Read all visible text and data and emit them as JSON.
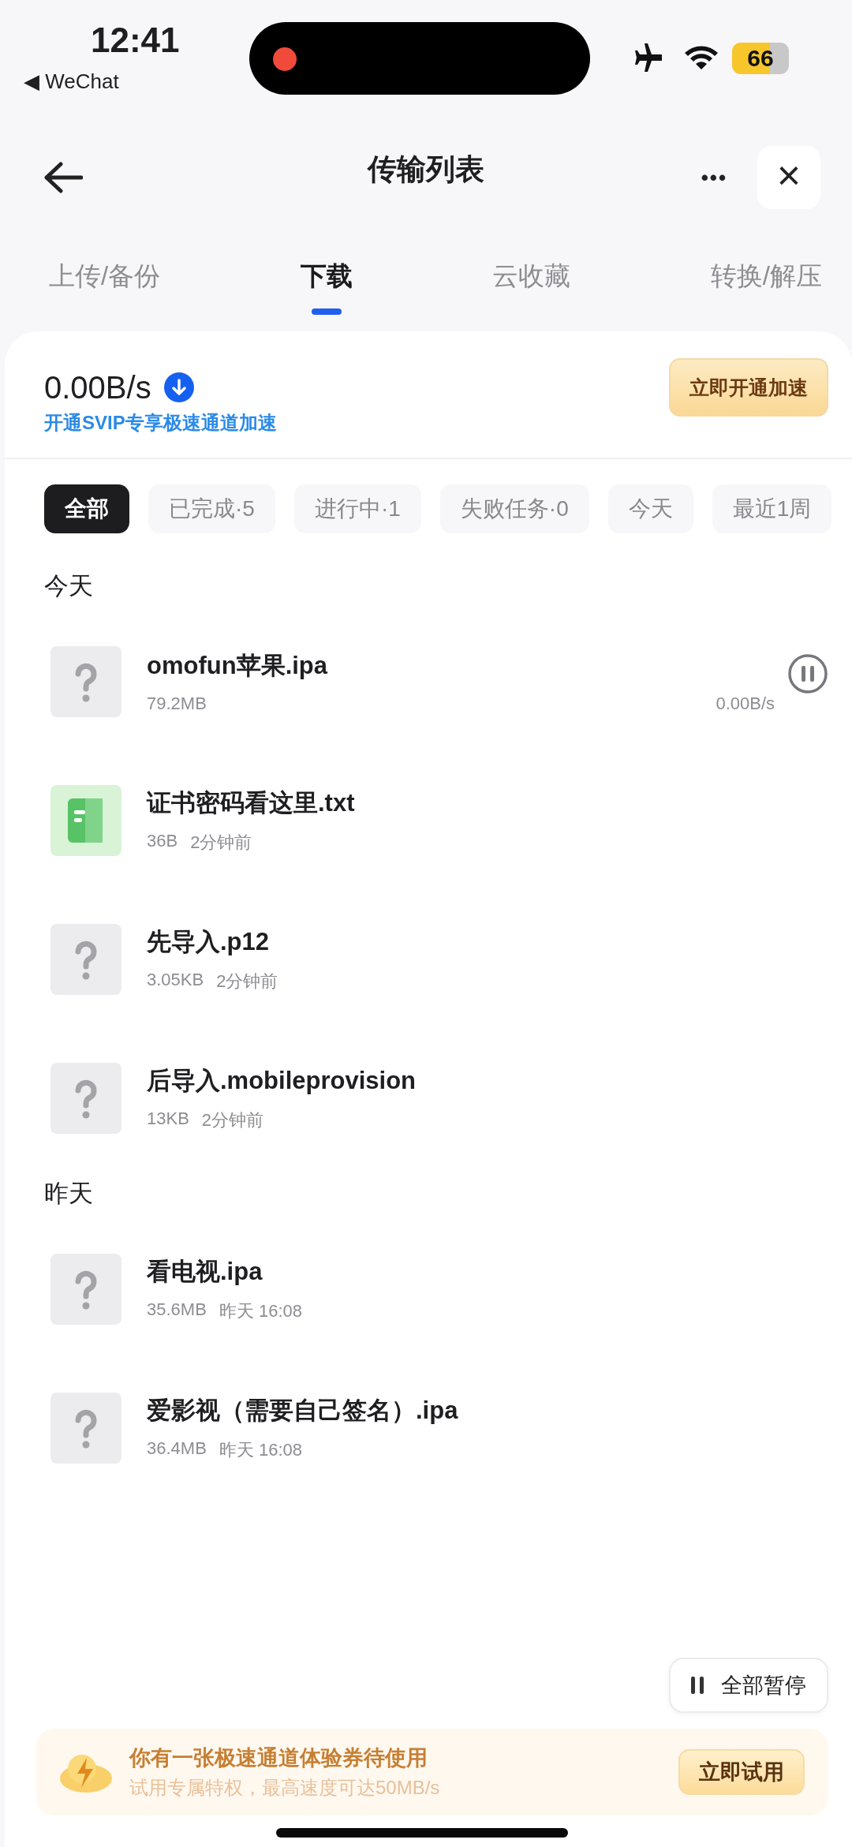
{
  "status_bar": {
    "time": "12:41",
    "back_app": "◀ WeChat",
    "battery": "66"
  },
  "header": {
    "title": "传输列表",
    "more": "•••",
    "close": "×"
  },
  "tabs": [
    {
      "label": "上传/备份",
      "selected": false
    },
    {
      "label": "下载",
      "selected": true
    },
    {
      "label": "云收藏",
      "selected": false
    },
    {
      "label": "转换/解压",
      "selected": false
    }
  ],
  "speed_panel": {
    "speed": "0.00B/s",
    "promo": "开通SVIP专享极速通道加速",
    "button": "立即开通加速"
  },
  "filters": [
    {
      "label": "全部",
      "selected": true
    },
    {
      "label": "已完成·5",
      "selected": false
    },
    {
      "label": "进行中·1",
      "selected": false
    },
    {
      "label": "失败任务·0",
      "selected": false
    },
    {
      "label": "今天",
      "selected": false
    },
    {
      "label": "最近1周",
      "selected": false
    }
  ],
  "sections": [
    {
      "title": "今天",
      "files": [
        {
          "kind": "unknown",
          "name": "omofun苹果.ipa",
          "size": "79.2MB",
          "speed": "0.00B/s",
          "downloading": true
        },
        {
          "kind": "text",
          "name": "证书密码看这里.txt",
          "size": "36B",
          "time": "2分钟前",
          "downloading": false
        },
        {
          "kind": "unknown",
          "name": "先导入.p12",
          "size": "3.05KB",
          "time": "2分钟前",
          "downloading": false
        },
        {
          "kind": "unknown",
          "name": "后导入.mobileprovision",
          "size": "13KB",
          "time": "2分钟前",
          "downloading": false
        }
      ]
    },
    {
      "title": "昨天",
      "files": [
        {
          "kind": "unknown",
          "name": "看电视.ipa",
          "size": "35.6MB",
          "time": "昨天 16:08",
          "downloading": false
        },
        {
          "kind": "unknown",
          "name": "爱影视（需要自己签名）.ipa",
          "size": "36.4MB",
          "time": "昨天 16:08",
          "downloading": false
        }
      ]
    }
  ],
  "pause_all": "全部暂停",
  "banner": {
    "title": "你有一张极速通道体验券待使用",
    "subtitle": "试用专属特权，最高速度可达50MB/s",
    "button": "立即试用"
  }
}
